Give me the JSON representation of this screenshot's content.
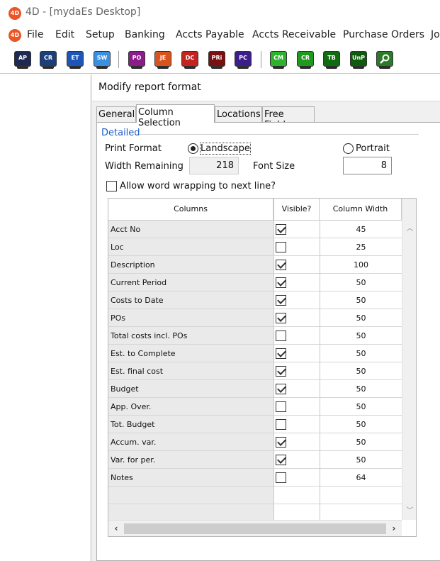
{
  "window": {
    "title": "4D - [mydaEs Desktop]",
    "logo_text": "4D"
  },
  "menu": {
    "items": [
      "File",
      "Edit",
      "Setup",
      "Banking",
      "Accts Payable",
      "Accts Receivable",
      "Purchase Orders",
      "Jo"
    ]
  },
  "toolbar": {
    "buttons": [
      {
        "label": "AP",
        "color": "#1f2a52"
      },
      {
        "label": "CR",
        "color": "#1a3f7a"
      },
      {
        "label": "ET",
        "color": "#1e56b8"
      },
      {
        "label": "SW",
        "color": "#3b8fe0"
      },
      {
        "label": "PO",
        "color": "#8b1d8b"
      },
      {
        "label": "JE",
        "color": "#d9531e"
      },
      {
        "label": "DC",
        "color": "#c4241f"
      },
      {
        "label": "PRi",
        "color": "#7a1010"
      },
      {
        "label": "PC",
        "color": "#3b1e8a"
      },
      {
        "label": "CM",
        "color": "#2db32d"
      },
      {
        "label": "CR",
        "color": "#1f9a1f"
      },
      {
        "label": "TB",
        "color": "#116b11"
      },
      {
        "label": "UnP",
        "color": "#0f5a0f"
      },
      {
        "label": "search-icon",
        "color": "#2a7a2a"
      }
    ]
  },
  "dialog": {
    "title": "Modify report format",
    "tabs": [
      "General",
      "Column Selection",
      "Locations",
      "Free Fields"
    ],
    "active_tab": "Column Selection",
    "group": "Detailed",
    "print_format_label": "Print Format",
    "landscape_label": "Landscape",
    "portrait_label": "Portrait",
    "selected_format": "Landscape",
    "width_remaining_label": "Width Remaining",
    "width_remaining_value": "218",
    "font_size_label": "Font Size",
    "font_size_value": "8",
    "word_wrap_label": "Allow word wrapping to next line?",
    "word_wrap_checked": false
  },
  "table": {
    "headers": [
      "Columns",
      "Visible?",
      "Column Width"
    ],
    "rows": [
      {
        "name": "Acct No",
        "visible": true,
        "width": "45"
      },
      {
        "name": "Loc",
        "visible": false,
        "width": "25"
      },
      {
        "name": "Description",
        "visible": true,
        "width": "100"
      },
      {
        "name": "Current Period",
        "visible": true,
        "width": "50"
      },
      {
        "name": "Costs to Date",
        "visible": true,
        "width": "50"
      },
      {
        "name": "POs",
        "visible": true,
        "width": "50"
      },
      {
        "name": "Total costs incl. POs",
        "visible": false,
        "width": "50"
      },
      {
        "name": "Est. to Complete",
        "visible": true,
        "width": "50"
      },
      {
        "name": "Est. final cost",
        "visible": true,
        "width": "50"
      },
      {
        "name": "Budget",
        "visible": true,
        "width": "50"
      },
      {
        "name": "App. Over.",
        "visible": false,
        "width": "50"
      },
      {
        "name": "Tot. Budget",
        "visible": false,
        "width": "50"
      },
      {
        "name": "Accum. var.",
        "visible": true,
        "width": "50"
      },
      {
        "name": "Var. for per.",
        "visible": true,
        "width": "50"
      },
      {
        "name": "Notes",
        "visible": false,
        "width": "64"
      },
      {
        "name": "",
        "visible": null,
        "width": ""
      },
      {
        "name": "",
        "visible": null,
        "width": ""
      }
    ]
  }
}
